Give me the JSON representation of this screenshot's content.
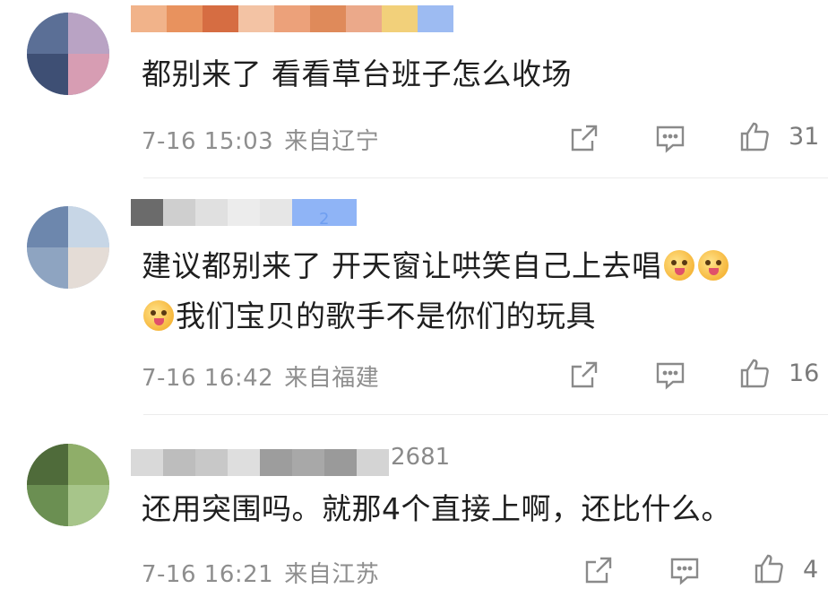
{
  "comments": [
    {
      "name_suffix": "",
      "text": "都别来了 看看草台班子怎么收场",
      "text_line2": "",
      "date": "7-16 15:03",
      "location": "来自辽宁",
      "likes": "31"
    },
    {
      "name_suffix": "2",
      "text": "建议都别来了 开天窗让哄笑自己上去唱",
      "text_line2": "我们宝贝的歌手不是你们的玩具",
      "date": "7-16 16:42",
      "location": "来自福建",
      "likes": "16"
    },
    {
      "name_suffix": "2681",
      "text": "还用突围吗。就那4个直接上啊，还比什么。",
      "text_line2": "",
      "date": "7-16 16:21",
      "location": "来自江苏",
      "likes": "4"
    }
  ],
  "icons": {
    "share": "share-icon",
    "reply": "comment-icon",
    "like": "thumbs-up-icon",
    "emoji": "yum-face-emoji"
  },
  "colors": {
    "text": "#1f1f1f",
    "meta": "#8e8e8e",
    "icon": "#8a8a8a",
    "badge": "#6e9ef0"
  }
}
